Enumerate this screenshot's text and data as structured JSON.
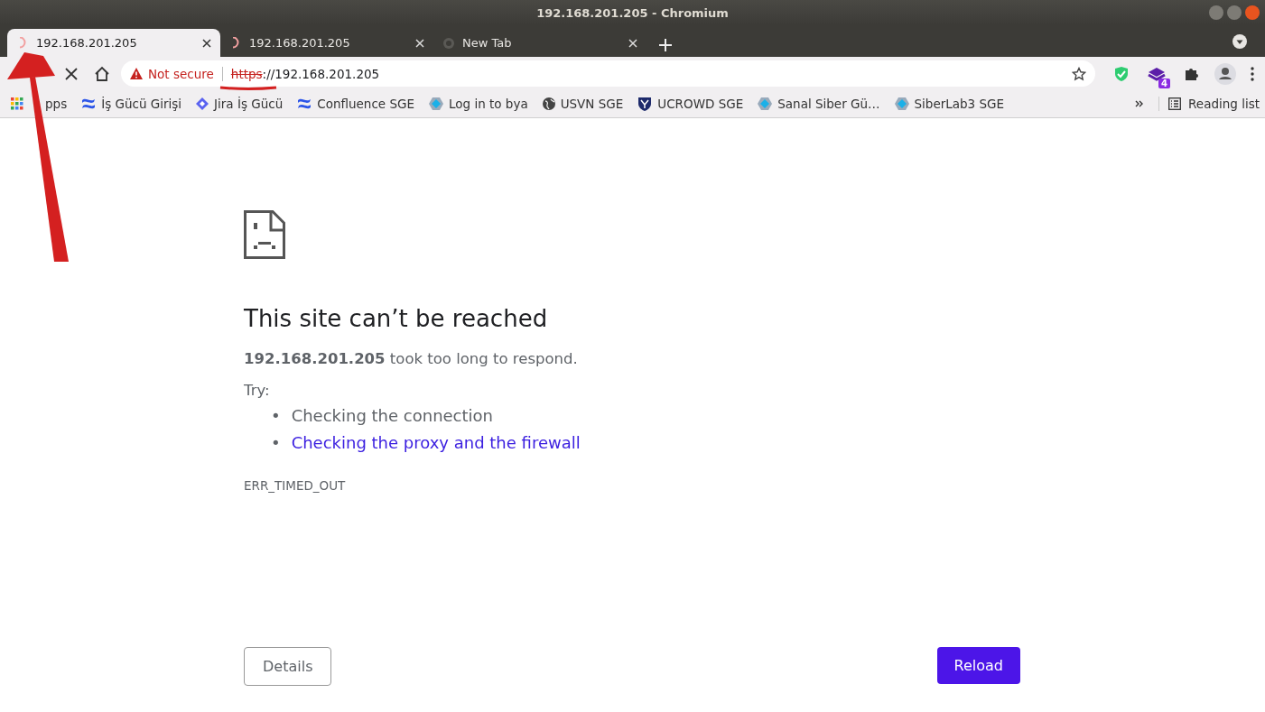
{
  "window": {
    "title": "192.168.201.205 - Chromium"
  },
  "tabs": [
    {
      "label": "192.168.201.205",
      "selected": true,
      "kind": "loading"
    },
    {
      "label": "192.168.201.205",
      "selected": false,
      "kind": "loading"
    },
    {
      "label": "New Tab",
      "selected": false,
      "kind": "page"
    }
  ],
  "toolbar": {
    "security_label": "Not secure",
    "url_scheme": "https",
    "url_rest": "://192.168.201.205",
    "extension_badge": "4"
  },
  "bookmarks": [
    {
      "label": "pps",
      "kind": "apps"
    },
    {
      "label": "İş Gücü Girişi",
      "kind": "wave"
    },
    {
      "label": "Jira İş Gücü",
      "kind": "diamond"
    },
    {
      "label": "Confluence SGE",
      "kind": "wave"
    },
    {
      "label": "Log in to bya",
      "kind": "hexagon"
    },
    {
      "label": "USVN SGE",
      "kind": "globe"
    },
    {
      "label": "UCROWD SGE",
      "kind": "shield"
    },
    {
      "label": "Sanal Siber Gü…",
      "kind": "hexagon"
    },
    {
      "label": "SiberLab3 SGE",
      "kind": "hexagon"
    }
  ],
  "reading_list": "Reading list",
  "error": {
    "heading": "This site can’t be reached",
    "summary": "**192.168.201.205** took too long to respond.",
    "try_label": "Try:",
    "suggestions": [
      {
        "marker": "•",
        "text": "Checking the connection",
        "kind": "text"
      },
      {
        "marker": "•",
        "text": "Checking the proxy and the firewall",
        "kind": "link"
      }
    ],
    "code": "ERR_TIMED_OUT"
  },
  "buttons": {
    "details": "Details",
    "reload": "Reload"
  }
}
